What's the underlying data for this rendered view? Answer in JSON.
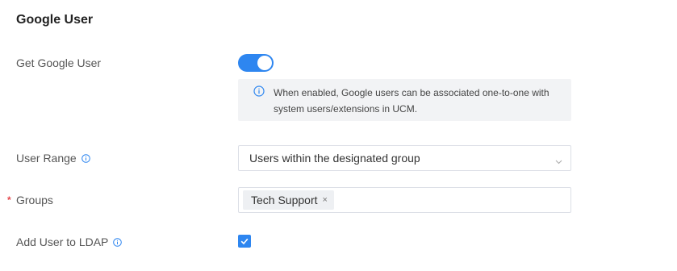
{
  "section": {
    "title": "Google User"
  },
  "get_google_user": {
    "label": "Get Google User",
    "enabled": true,
    "info_text": "When enabled, Google users can be associated one-to-one with system users/extensions in UCM."
  },
  "user_range": {
    "label": "User Range",
    "value": "Users within the designated group"
  },
  "groups": {
    "label": "Groups",
    "required_mark": "*",
    "tags": [
      "Tech Support"
    ],
    "remove_glyph": "×"
  },
  "add_user_to_ldap": {
    "label": "Add User to LDAP",
    "checked": true
  },
  "colors": {
    "accent": "#2e86f0",
    "required": "#e5484d",
    "info_bg": "#f2f3f5"
  },
  "icons": {
    "info": "info-circle-icon",
    "chevron": "chevron-down-icon",
    "check": "check-icon",
    "close": "close-icon"
  }
}
